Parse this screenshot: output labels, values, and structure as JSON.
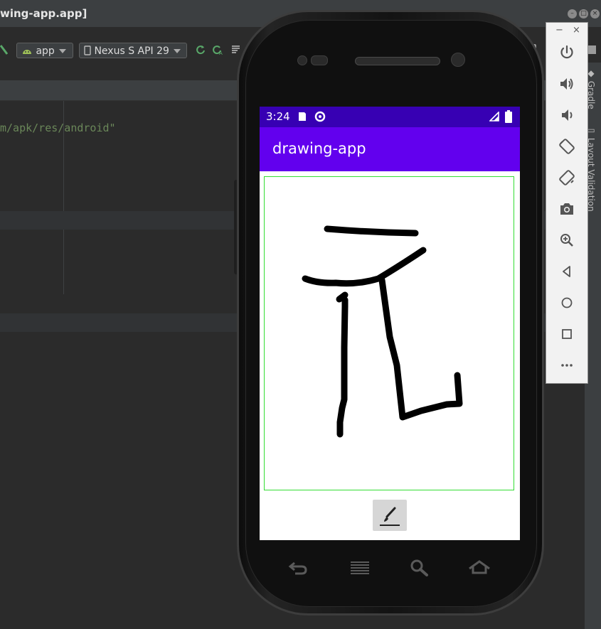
{
  "ide": {
    "window_title": "wing-app.app]",
    "run_config": "app",
    "device": "Nexus S API 29",
    "code_text": "m/apk/res/android\"",
    "right_tools": [
      "Gradle",
      "Layout Validation"
    ]
  },
  "phone": {
    "status_time": "3:24",
    "app_title": "drawing-app",
    "brush_button_icon": "paintbrush-icon",
    "nav_keys": [
      "back-icon",
      "menu-icon",
      "search-icon",
      "home-icon"
    ]
  },
  "emulator_controls": {
    "window_buttons": [
      "−",
      "×"
    ],
    "actions": [
      "power-icon",
      "volume-up-icon",
      "volume-down-icon",
      "rotate-left-icon",
      "rotate-right-icon",
      "screenshot-icon",
      "zoom-icon",
      "back-icon",
      "home-icon",
      "overview-icon",
      "more-icon"
    ]
  },
  "colors": {
    "status_bar": "#3700b3",
    "app_bar": "#6200ee",
    "canvas_border": "#33dd33",
    "ide_background": "#2b2b2b"
  }
}
